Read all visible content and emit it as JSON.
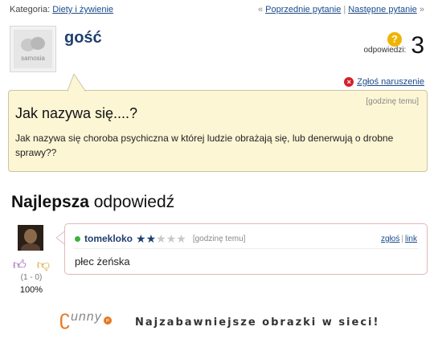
{
  "topbar": {
    "category_label": "Kategoria:",
    "category_link": "Diety i żywienie",
    "prev_arrow": "«",
    "prev_link": "Poprzednie pytanie",
    "separator": "|",
    "next_link": "Następne pytanie",
    "next_arrow": "»"
  },
  "asker": {
    "avatar_logo_text": "samosia",
    "name": "gość"
  },
  "answers": {
    "icon": "question-mark-icon",
    "label": "odpowiedzi:",
    "count": "3"
  },
  "report": {
    "icon": "report-icon",
    "label": "Zgłoś naruszenie"
  },
  "question": {
    "time": "[godzinę temu]",
    "title": "Jak nazywa się....?",
    "body": "Jak nazywa się choroba psychiczna w której ludzie obrażają się, lub denerwują o drobne sprawy??"
  },
  "best_answer": {
    "heading_bold": "Najlepsza",
    "heading_rest": "odpowiedź",
    "user": "tomekloko",
    "rating": 2,
    "rating_max": 5,
    "time": "[godzinę temu]",
    "report_link": "zgłoś",
    "separator": "|",
    "permalink": "link",
    "text": "płec żeńska",
    "votes": "(1 - 0)",
    "percent": "100%"
  },
  "footer": {
    "logo_swirl": "ʗ",
    "logo_word": "unny",
    "logo_suffix": "pl",
    "tagline": "Najzabawniejsze obrazki w sieci!"
  },
  "colors": {
    "link": "#1a4a8a",
    "question_bg": "#fdf6d5",
    "username": "#1f3f6e",
    "report_red": "#d4202a",
    "brand_orange": "#e8761e"
  }
}
